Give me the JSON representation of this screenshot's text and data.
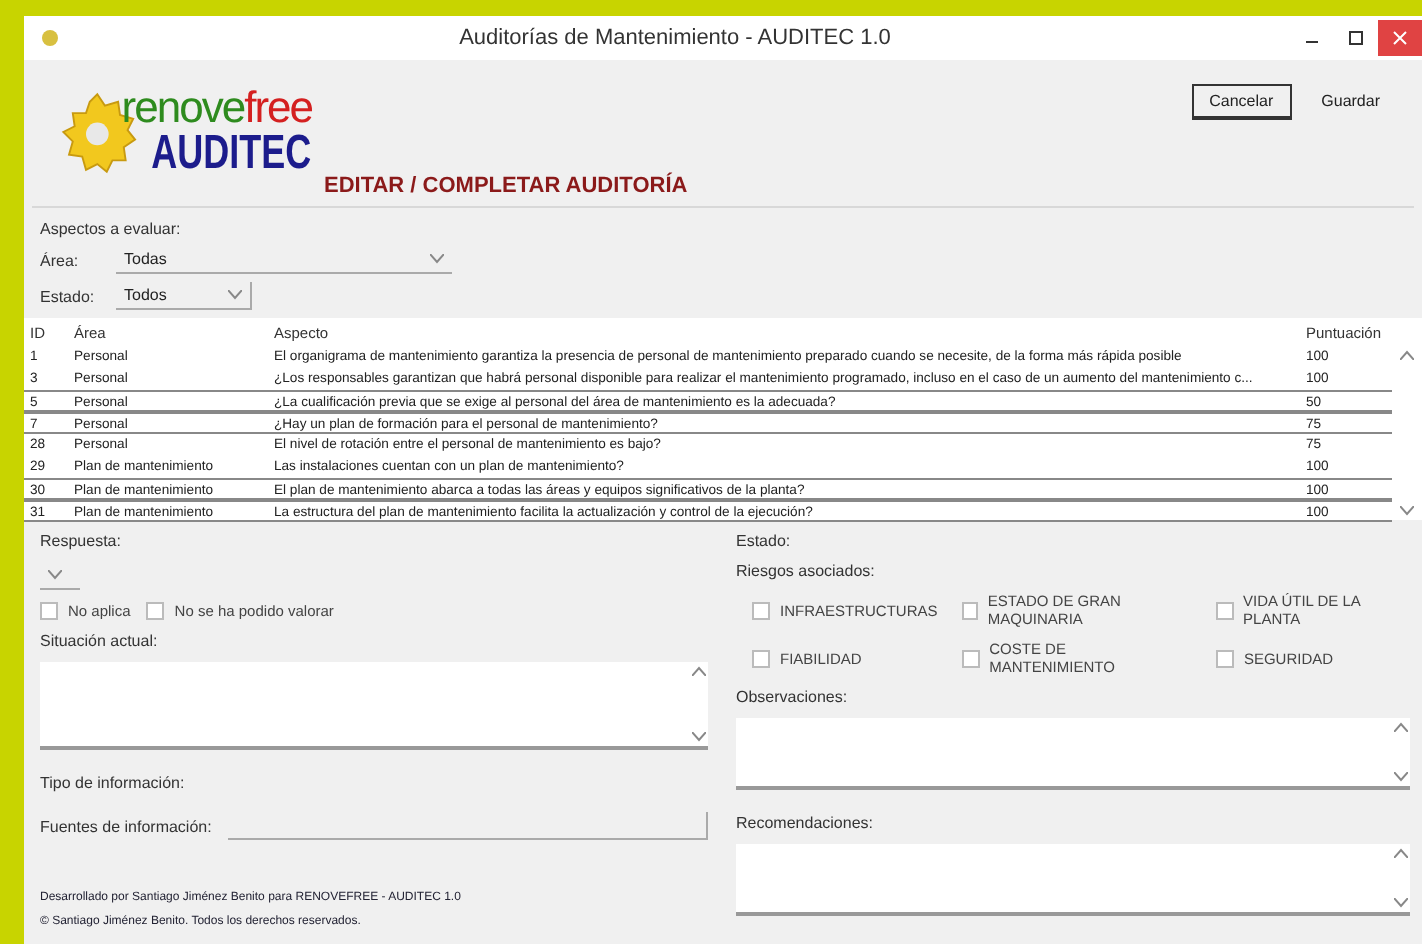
{
  "window": {
    "title": "Auditorías de Mantenimiento - AUDITEC 1.0"
  },
  "logo": {
    "name_start": "renove",
    "name_end": "free",
    "product": "AUDITEC"
  },
  "page_title": "EDITAR / COMPLETAR AUDITORÍA",
  "buttons": [
    {
      "label": "Cancelar",
      "focused": true
    },
    {
      "label": "Guardar",
      "focused": false
    }
  ],
  "filters": {
    "label": "Aspectos a evaluar:",
    "area": {
      "label": "Área:",
      "value": "Todas"
    },
    "status": {
      "label": "Estado:",
      "value": "Todos"
    }
  },
  "table": {
    "columns": [
      "ID",
      "Área",
      "Aspecto",
      "Puntuación"
    ],
    "rows": [
      {
        "cells": [
          "1",
          "Personal",
          "El organigrama de mantenimiento garantiza la presencia de personal de mantenimiento preparado cuando se necesite, de la forma más rápida posible",
          "100"
        ],
        "boxed": false
      },
      {
        "cells": [
          "3",
          "Personal",
          "¿Los responsables garantizan que habrá personal disponible para realizar el mantenimiento programado, incluso en el caso de un aumento del mantenimiento c...",
          "100"
        ],
        "boxed": false
      },
      {
        "cells": [
          "5",
          "Personal",
          "¿La cualificación previa que se exige al personal del área de mantenimiento es la adecuada?",
          "50"
        ],
        "boxed": true
      },
      {
        "cells": [
          "7",
          "Personal",
          "¿Hay un plan de formación para el personal de mantenimiento?",
          "75"
        ],
        "boxed": true
      },
      {
        "cells": [
          "28",
          "Personal",
          "El nivel de rotación entre el personal de mantenimiento es bajo?",
          "75"
        ],
        "boxed": false
      },
      {
        "cells": [
          "29",
          "Plan de mantenimiento",
          "Las instalaciones cuentan con un plan de mantenimiento?",
          "100"
        ],
        "boxed": false
      },
      {
        "cells": [
          "30",
          "Plan de mantenimiento",
          "El plan de mantenimiento abarca a todas las áreas y equipos significativos de la planta?",
          "100"
        ],
        "boxed": true
      },
      {
        "cells": [
          "31",
          "Plan de mantenimiento",
          "La estructura del plan de mantenimiento facilita la actualización y control de la ejecución?",
          "100"
        ],
        "boxed": true
      }
    ]
  },
  "answer": {
    "label": "Respuesta:",
    "options": [
      {
        "label": "No aplica",
        "checked": false
      },
      {
        "label": "No se ha podido valorar",
        "checked": false
      }
    ]
  },
  "situation": {
    "label": "Situación actual:"
  },
  "info_type": {
    "label": "Tipo de información:"
  },
  "info_sources": {
    "label": "Fuentes de información:"
  },
  "footer": [
    "Desarrollado por Santiago Jiménez Benito para RENOVEFREE - AUDITEC 1.0",
    "© Santiago Jiménez Benito. Todos los derechos reservados."
  ],
  "status": {
    "label": "Estado:"
  },
  "risks": {
    "label": "Riesgos asociados:",
    "items": [
      {
        "label": "INFRAESTRUCTURAS",
        "checked": false
      },
      {
        "label": "ESTADO DE GRAN MAQUINARIA",
        "checked": false
      },
      {
        "label": "VIDA ÚTIL DE LA PLANTA",
        "checked": false
      },
      {
        "label": "FIABILIDAD",
        "checked": false
      },
      {
        "label": "COSTE DE MANTENIMIENTO",
        "checked": false
      },
      {
        "label": "SEGURIDAD",
        "checked": false
      }
    ]
  },
  "observations": {
    "label": "Observaciones:"
  },
  "recommendations": {
    "label": "Recomendaciones:"
  }
}
